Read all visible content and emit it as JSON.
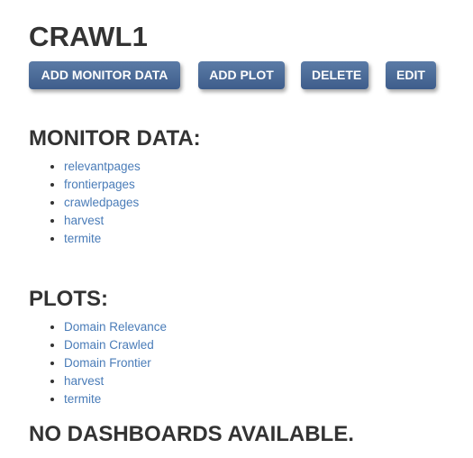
{
  "page": {
    "title": "CRAWL1"
  },
  "toolbar": {
    "add_monitor_label": "ADD MONITOR DATA",
    "add_plot_label": "ADD PLOT",
    "delete_label": "DELETE",
    "edit_label": "EDIT"
  },
  "monitor_data": {
    "heading": "MONITOR DATA:",
    "items": [
      "relevantpages",
      "frontierpages",
      "crawledpages",
      "harvest",
      "termite"
    ]
  },
  "plots": {
    "heading": "PLOTS:",
    "items": [
      "Domain Relevance",
      "Domain Crawled",
      "Domain Frontier",
      "harvest",
      "termite"
    ]
  },
  "dashboards": {
    "heading": "NO DASHBOARDS AVAILABLE."
  },
  "colors": {
    "button_top": "#5b7ba6",
    "button_bottom": "#3e5d8b",
    "link": "#4a7cb8",
    "heading": "#333333"
  }
}
